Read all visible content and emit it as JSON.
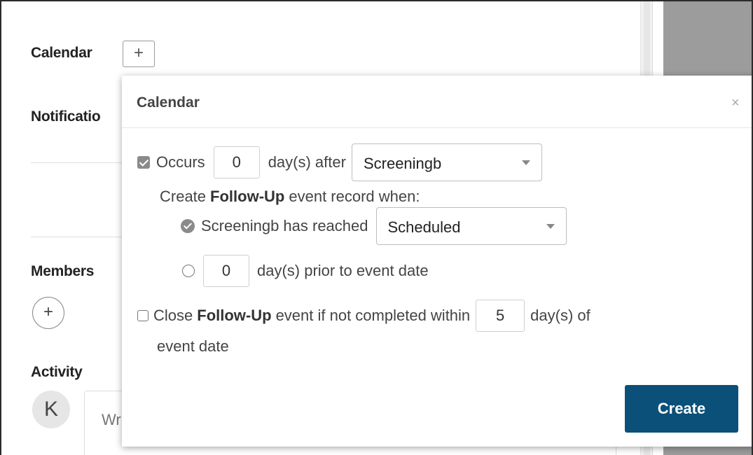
{
  "background": {
    "calendar_heading": "Calendar",
    "add_calendar_symbol": "+",
    "notifications_heading": "Notificatio",
    "members_heading": "Members",
    "add_member_symbol": "+",
    "activity_heading": "Activity",
    "avatar_initial": "K",
    "comment_placeholder": "Wr"
  },
  "modal": {
    "title": "Calendar",
    "close_symbol": "×",
    "occurs": {
      "checked": true,
      "label": "Occurs",
      "days_value": "0",
      "after_label": "day(s) after",
      "event_select": "Screeningb"
    },
    "create_followup": {
      "prefix": "Create",
      "bold": "Follow-Up",
      "suffix": "event record when:"
    },
    "reached_option": {
      "selected": true,
      "label": "Screeningb has reached",
      "status_select": "Scheduled"
    },
    "prior_option": {
      "selected": false,
      "days_value": "0",
      "label": "day(s) prior to event date"
    },
    "close_followup": {
      "checked": false,
      "prefix": "Close",
      "bold": "Follow-Up",
      "middle": "event if not completed within",
      "days_value": "5",
      "suffix": "day(s) of",
      "line2": "event date"
    },
    "create_button": "Create"
  },
  "colors": {
    "primary_button": "#0b5079",
    "checkbox_fill": "#8a8a8a",
    "right_panel": "#9c9c9c"
  }
}
